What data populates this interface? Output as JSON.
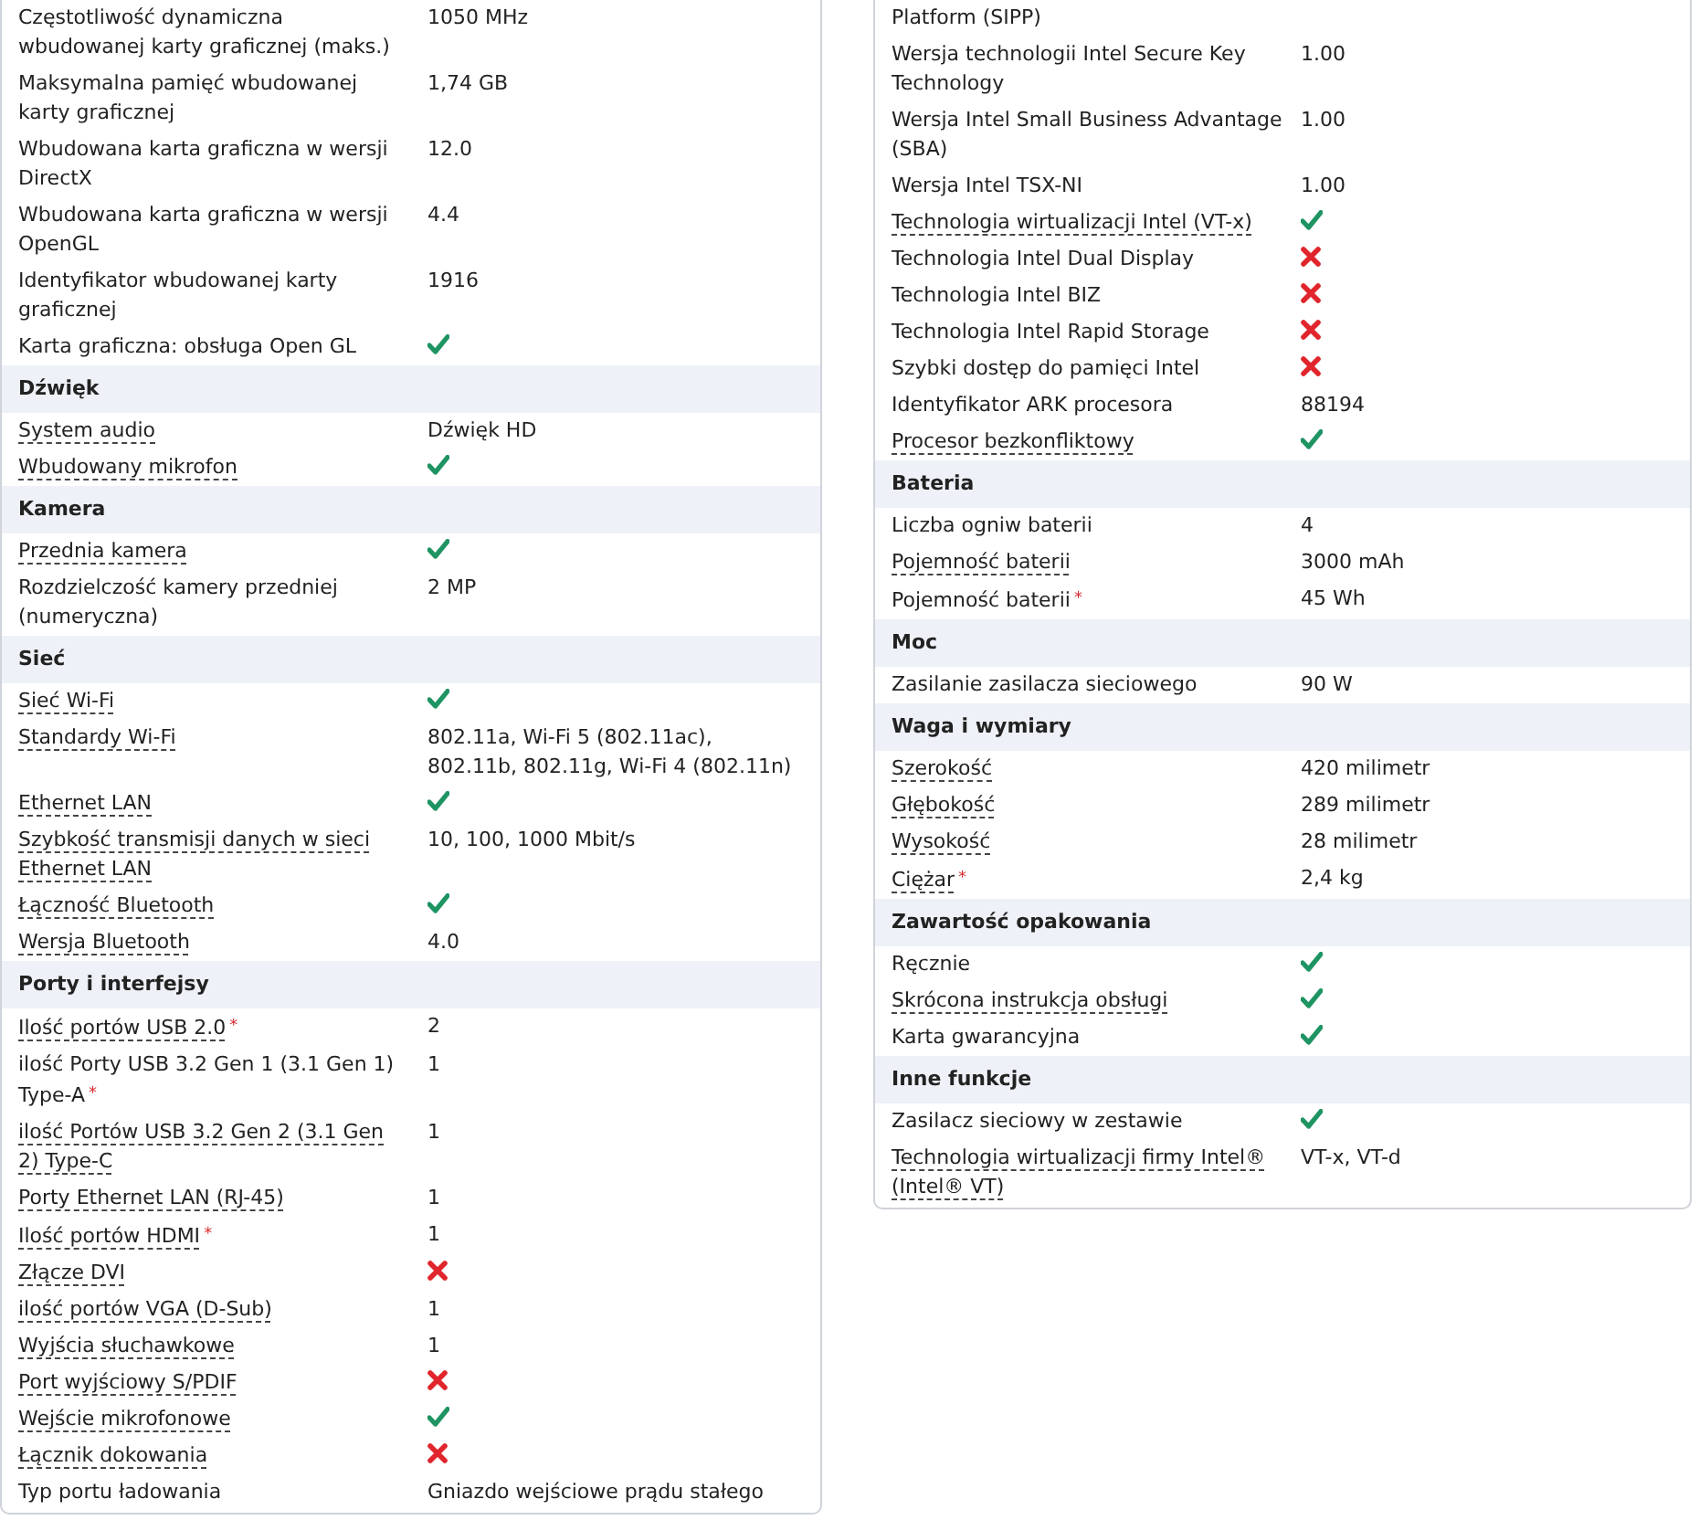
{
  "columns": [
    {
      "sections": [
        {
          "rows": [
            {
              "label": "Częstotliwość dynamiczna wbudowanej karty graficznej (maks.)",
              "dotted": false,
              "kind": "text",
              "value": "1050 MHz"
            },
            {
              "label": "Maksymalna pamięć wbudowanej karty graficznej",
              "dotted": false,
              "kind": "text",
              "value": "1,74 GB"
            },
            {
              "label": "Wbudowana karta graficzna w wersji DirectX",
              "dotted": false,
              "kind": "text",
              "value": "12.0"
            },
            {
              "label": "Wbudowana karta graficzna w wersji OpenGL",
              "dotted": false,
              "kind": "text",
              "value": "4.4"
            },
            {
              "label": "Identyfikator wbudowanej karty graficznej",
              "dotted": false,
              "kind": "text",
              "value": "1916"
            },
            {
              "label": "Karta graficzna: obsługa Open GL",
              "dotted": false,
              "kind": "flag",
              "supported": true
            }
          ]
        },
        {
          "title": "Dźwięk",
          "rows": [
            {
              "label": "System audio",
              "dotted": true,
              "kind": "text",
              "value": "Dźwięk HD"
            },
            {
              "label": "Wbudowany mikrofon",
              "dotted": true,
              "kind": "flag",
              "supported": true
            }
          ]
        },
        {
          "title": "Kamera",
          "rows": [
            {
              "label": "Przednia kamera",
              "dotted": true,
              "kind": "flag",
              "supported": true
            },
            {
              "label": "Rozdzielczość kamery przedniej (numeryczna)",
              "dotted": false,
              "kind": "text",
              "value": "2 MP"
            }
          ]
        },
        {
          "title": "Sieć",
          "rows": [
            {
              "label": "Sieć Wi-Fi",
              "dotted": true,
              "kind": "flag",
              "supported": true
            },
            {
              "label": "Standardy Wi-Fi",
              "dotted": true,
              "kind": "text",
              "value": "802.11a, Wi-Fi 5 (802.11ac), 802.11b, 802.11g, Wi-Fi 4 (802.11n)"
            },
            {
              "label": "Ethernet LAN",
              "dotted": true,
              "kind": "flag",
              "supported": true
            },
            {
              "label": "Szybkość transmisji danych w sieci Ethernet LAN",
              "dotted": true,
              "kind": "text",
              "value": "10, 100, 1000 Mbit/s"
            },
            {
              "label": "Łączność Bluetooth",
              "dotted": true,
              "kind": "flag",
              "supported": true
            },
            {
              "label": "Wersja Bluetooth",
              "dotted": true,
              "kind": "text",
              "value": "4.0"
            }
          ]
        },
        {
          "title": "Porty i interfejsy",
          "rows": [
            {
              "label": "Ilość portów USB 2.0",
              "mark": "*",
              "dotted": true,
              "kind": "text",
              "value": "2"
            },
            {
              "label": "ilość Porty USB 3.2 Gen 1 (3.1 Gen 1) Type-A",
              "mark": "*",
              "dotted": false,
              "kind": "text",
              "value": "1"
            },
            {
              "label": "ilość Portów USB 3.2 Gen 2 (3.1 Gen 2) Type-C",
              "dotted": true,
              "kind": "text",
              "value": "1"
            },
            {
              "label": "Porty Ethernet LAN (RJ-45)",
              "dotted": true,
              "kind": "text",
              "value": "1"
            },
            {
              "label": "Ilość portów HDMI",
              "mark": "*",
              "dotted": true,
              "kind": "text",
              "value": "1"
            },
            {
              "label": "Złącze DVI",
              "dotted": true,
              "kind": "flag",
              "supported": false
            },
            {
              "label": "ilość portów VGA (D-Sub)",
              "dotted": true,
              "kind": "text",
              "value": "1"
            },
            {
              "label": "Wyjścia słuchawkowe",
              "dotted": true,
              "kind": "text",
              "value": "1"
            },
            {
              "label": "Port wyjściowy S/PDIF",
              "dotted": true,
              "kind": "flag",
              "supported": false
            },
            {
              "label": "Wejście mikrofonowe",
              "dotted": true,
              "kind": "flag",
              "supported": true
            },
            {
              "label": "Łącznik dokowania",
              "dotted": true,
              "kind": "flag",
              "supported": false
            },
            {
              "label": "Typ portu ładowania",
              "dotted": false,
              "kind": "text",
              "value": "Gniazdo wejściowe prądu stałego"
            }
          ]
        }
      ]
    },
    {
      "sections": [
        {
          "rows": [
            {
              "label": "Platform (SIPP)",
              "dotted": false,
              "kind": "label-only"
            },
            {
              "label": "Wersja technologii Intel Secure Key Technology",
              "dotted": false,
              "kind": "text",
              "value": "1.00"
            },
            {
              "label": "Wersja Intel Small Business Advantage (SBA)",
              "dotted": false,
              "kind": "text",
              "value": "1.00"
            },
            {
              "label": "Wersja Intel TSX-NI",
              "dotted": false,
              "kind": "text",
              "value": "1.00"
            },
            {
              "label": "Technologia wirtualizacji Intel (VT-x)",
              "dotted": true,
              "kind": "flag",
              "supported": true
            },
            {
              "label": "Technologia Intel Dual Display",
              "dotted": false,
              "kind": "flag",
              "supported": false
            },
            {
              "label": "Technologia Intel BIZ",
              "dotted": false,
              "kind": "flag",
              "supported": false
            },
            {
              "label": "Technologia Intel Rapid Storage",
              "dotted": false,
              "kind": "flag",
              "supported": false
            },
            {
              "label": "Szybki dostęp do pamięci Intel",
              "dotted": false,
              "kind": "flag",
              "supported": false
            },
            {
              "label": "Identyfikator ARK procesora",
              "dotted": false,
              "kind": "text",
              "value": "88194"
            },
            {
              "label": "Procesor bezkonfliktowy",
              "dotted": true,
              "kind": "flag",
              "supported": true
            }
          ]
        },
        {
          "title": "Bateria",
          "rows": [
            {
              "label": "Liczba ogniw baterii",
              "dotted": false,
              "kind": "text",
              "value": "4"
            },
            {
              "label": "Pojemność baterii",
              "dotted": true,
              "kind": "text",
              "value": "3000 mAh"
            },
            {
              "label": "Pojemność baterii",
              "mark": "*",
              "dotted": false,
              "kind": "text",
              "value": "45 Wh"
            }
          ]
        },
        {
          "title": "Moc",
          "rows": [
            {
              "label": "Zasilanie zasilacza sieciowego",
              "dotted": false,
              "kind": "text",
              "value": "90 W"
            }
          ]
        },
        {
          "title": "Waga i wymiary",
          "rows": [
            {
              "label": "Szerokość",
              "dotted": true,
              "kind": "text",
              "value": "420 milimetr"
            },
            {
              "label": "Głębokość",
              "dotted": true,
              "kind": "text",
              "value": "289 milimetr"
            },
            {
              "label": "Wysokość",
              "dotted": true,
              "kind": "text",
              "value": "28 milimetr"
            },
            {
              "label": "Ciężar",
              "mark": "*",
              "dotted": true,
              "kind": "text",
              "value": "2,4 kg"
            }
          ]
        },
        {
          "title": "Zawartość opakowania",
          "rows": [
            {
              "label": "Ręcznie",
              "dotted": false,
              "kind": "flag",
              "supported": true
            },
            {
              "label": "Skrócona instrukcja obsługi",
              "dotted": true,
              "kind": "flag",
              "supported": true
            },
            {
              "label": "Karta gwarancyjna",
              "dotted": false,
              "kind": "flag",
              "supported": true
            }
          ]
        },
        {
          "title": "Inne funkcje",
          "rows": [
            {
              "label": "Zasilacz sieciowy w zestawie",
              "dotted": false,
              "kind": "flag",
              "supported": true
            },
            {
              "label": "Technologia wirtualizacji firmy Intel® (Intel® VT)",
              "dotted": true,
              "kind": "text",
              "value": "VT-x, VT-d"
            }
          ]
        }
      ]
    }
  ]
}
